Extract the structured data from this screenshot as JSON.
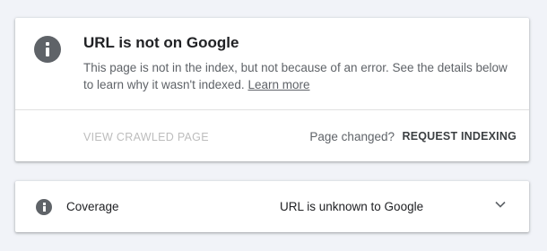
{
  "status_card": {
    "title": "URL is not on Google",
    "description": "This page is not in the index, but not because of an error. See the details below to learn why it wasn't indexed.",
    "learn_more": "Learn more",
    "view_crawled_page": "VIEW CRAWLED PAGE",
    "page_changed": "Page changed?",
    "request_indexing": "REQUEST INDEXING"
  },
  "coverage": {
    "label": "Coverage",
    "value": "URL is unknown to Google"
  },
  "colors": {
    "background": "#f1f3f8",
    "icon": "#5f6368",
    "disabled_text": "#bdbdbd"
  },
  "icons": [
    "info-icon",
    "chevron-down-icon"
  ]
}
